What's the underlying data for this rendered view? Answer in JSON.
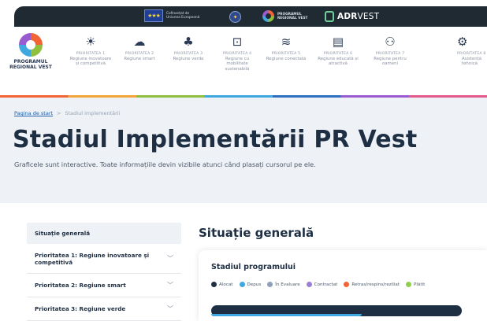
{
  "topbar": {
    "eu_logo_text": "Cofinanțat de Uniunea Europeană",
    "program_logo_text": "PROGRAMUL REGIONAL VEST",
    "adr_bold": "ADR",
    "adr_rest": "VEST"
  },
  "brand": {
    "name": "PROGRAMUL REGIONAL VEST"
  },
  "priorities": [
    {
      "num": "PRIORITATEA 1",
      "name": "Regiune inovatoare și competitivă",
      "icon": "lightbulb-icon",
      "glyph": "☀"
    },
    {
      "num": "PRIORITATEA 2",
      "name": "Regiune smart",
      "icon": "cloud-icon",
      "glyph": "☁"
    },
    {
      "num": "PRIORITATEA 3",
      "name": "Regiune verde",
      "icon": "tree-icon",
      "glyph": "♣"
    },
    {
      "num": "PRIORITATEA 4",
      "name": "Regiune cu mobilitate sustenabilă",
      "icon": "bus-icon",
      "glyph": "⊡"
    },
    {
      "num": "PRIORITATEA 5",
      "name": "Regiune conectată",
      "icon": "road-icon",
      "glyph": "≋"
    },
    {
      "num": "PRIORITATEA 6",
      "name": "Regiune educată și atractivă",
      "icon": "school-icon",
      "glyph": "▤"
    },
    {
      "num": "PRIORITATEA 7",
      "name": "Regiune pentru oameni",
      "icon": "people-icon",
      "glyph": "⚇"
    },
    {
      "num": "PRIORITATEA 8",
      "name": "Asistență tehnică",
      "icon": "support-icon",
      "glyph": "⚙"
    }
  ],
  "breadcrumb": {
    "home": "Pagina de start",
    "separator": ">",
    "current": "Stadiul implementării"
  },
  "hero": {
    "title": "Stadiul Implementării PR Vest",
    "subtitle": "Graficele sunt interactive. Toate informațiile devin vizibile atunci când plasați cursorul pe ele."
  },
  "sidebar": {
    "items": [
      {
        "label": "Situație generală"
      },
      {
        "label": "Prioritatea 1: Regiune inovatoare și competitivă"
      },
      {
        "label": "Prioritatea 2: Regiune smart"
      },
      {
        "label": "Prioritatea 3: Regiune verde"
      }
    ]
  },
  "main": {
    "section_title": "Situație generală",
    "card_title": "Stadiul programului",
    "legend": [
      {
        "label": "Alocat",
        "color": "#1e2f44"
      },
      {
        "label": "Depus",
        "color": "#3fa8e0"
      },
      {
        "label": "În Evaluare",
        "color": "#8fa0b8"
      },
      {
        "label": "Contractat",
        "color": "#9b7fd4"
      },
      {
        "label": "Retras/respins/reziliat",
        "color": "#f06436"
      },
      {
        "label": "Plătit",
        "color": "#8fcf4a"
      }
    ]
  },
  "colors": {
    "dark": "#1f2a33",
    "navy": "#1e2f44",
    "hero_bg": "#eef1f5",
    "accent_blue": "#3fa8e0"
  }
}
